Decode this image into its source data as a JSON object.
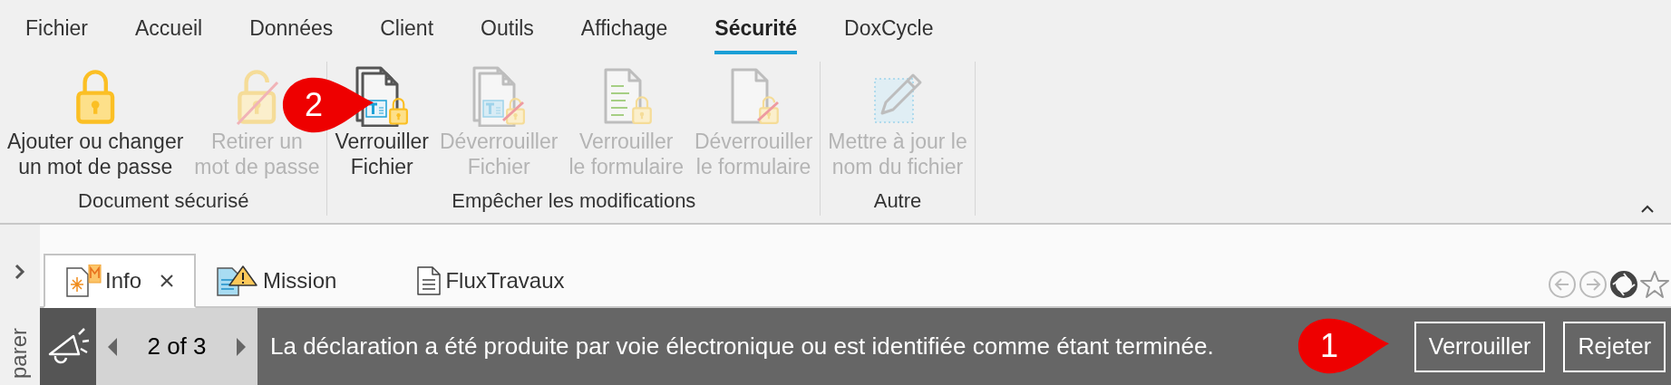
{
  "menu_tabs": [
    {
      "label": "Fichier",
      "selected": false
    },
    {
      "label": "Accueil",
      "selected": false
    },
    {
      "label": "Données",
      "selected": false
    },
    {
      "label": "Client",
      "selected": false
    },
    {
      "label": "Outils",
      "selected": false
    },
    {
      "label": "Affichage",
      "selected": false
    },
    {
      "label": "Sécurité",
      "selected": true
    },
    {
      "label": "DoxCycle",
      "selected": false
    }
  ],
  "ribbon_groups": [
    {
      "label": "Document sécurisé",
      "buttons": [
        {
          "kind": "lock",
          "lines": [
            "Ajouter ou changer",
            "un mot de passe"
          ],
          "disabled": false
        },
        {
          "kind": "unlock",
          "lines": [
            "Retirer un",
            "mot de passe"
          ],
          "disabled": true
        }
      ]
    },
    {
      "label": "Empêcher les modifications",
      "buttons": [
        {
          "kind": "filelock",
          "lines": [
            "Verrouiller",
            "Fichier"
          ],
          "disabled": false
        },
        {
          "kind": "fileunlock",
          "lines": [
            "Déverrouiller",
            "Fichier"
          ],
          "disabled": true
        },
        {
          "kind": "formlock",
          "lines": [
            "Verrouiller",
            "le formulaire"
          ],
          "disabled": true
        },
        {
          "kind": "formunlock",
          "lines": [
            "Déverrouiller",
            "le formulaire"
          ],
          "disabled": true
        }
      ]
    },
    {
      "label": "Autre",
      "buttons": [
        {
          "kind": "rename",
          "lines": [
            "Mettre à jour le",
            "nom du fichier"
          ],
          "disabled": true
        }
      ]
    }
  ],
  "side_panel": {
    "label": "parer"
  },
  "doc_tabs": [
    {
      "label": "Info",
      "kind": "info",
      "selected": true,
      "closable": true
    },
    {
      "label": "Mission",
      "kind": "mission",
      "selected": false,
      "closable": false
    },
    {
      "label": "FluxTravaux",
      "kind": "doc",
      "selected": false,
      "closable": false
    }
  ],
  "notification": {
    "counter": "2 of 3",
    "message": "La déclaration a été produite par voie électronique ou est identifiée comme étant terminée.",
    "buttons": [
      "Verrouiller",
      "Rejeter"
    ]
  },
  "callouts": [
    {
      "number": "2"
    },
    {
      "number": "1"
    }
  ]
}
